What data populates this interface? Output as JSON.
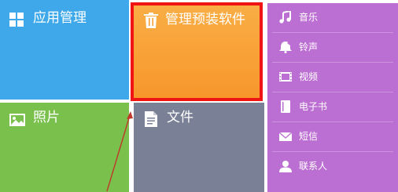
{
  "tiles": {
    "apps": {
      "label": "应用管理",
      "icon": "grid-icon",
      "color": "#3ea8ea"
    },
    "preinstalled": {
      "label": "管理预装软件",
      "icon": "trash-icon",
      "color": "#f7a03a",
      "highlighted": true
    },
    "photos": {
      "label": "照片",
      "icon": "image-icon",
      "color": "#79c04c"
    },
    "files": {
      "label": "文件",
      "icon": "document-icon",
      "color": "#7a8196"
    }
  },
  "media": {
    "color": "#bc6fd2",
    "items": [
      {
        "label": "音乐",
        "icon": "music-icon"
      },
      {
        "label": "铃声",
        "icon": "ringtone-icon"
      },
      {
        "label": "视频",
        "icon": "video-icon"
      },
      {
        "label": "电子书",
        "icon": "book-icon"
      },
      {
        "label": "短信",
        "icon": "envelope-icon"
      },
      {
        "label": "联系人",
        "icon": "person-icon"
      }
    ]
  },
  "annotation": {
    "highlight_color": "#f01414",
    "arrow_color": "#c0392b"
  }
}
